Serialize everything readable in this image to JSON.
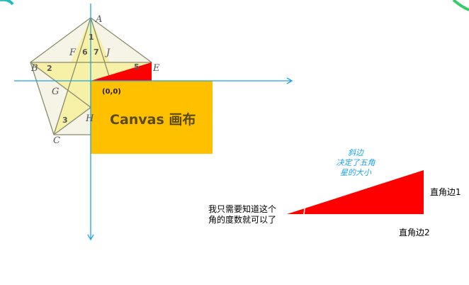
{
  "pentagon": {
    "labels": {
      "A": "A",
      "B": "B",
      "C": "C",
      "E": "E",
      "F": "F",
      "G": "G",
      "H": "H",
      "J": "J"
    },
    "angles": [
      "1",
      "2",
      "3",
      "6",
      "7",
      "5"
    ]
  },
  "canvas": {
    "origin": "(0,0)",
    "title": "Canvas 画布",
    "color": "#FFC000"
  },
  "triangle": {
    "color": "#FF0000",
    "hypotenuse": [
      "斜边",
      "决定了五角",
      "星的大小"
    ],
    "leg1": "直角边1",
    "leg2": "直角边2",
    "angle_note": [
      "我只需要知道这个",
      "角的度数就可以了"
    ]
  },
  "colors": {
    "axis": "#1AA3E8",
    "hypotenuse_text": "#1AA3E8"
  }
}
